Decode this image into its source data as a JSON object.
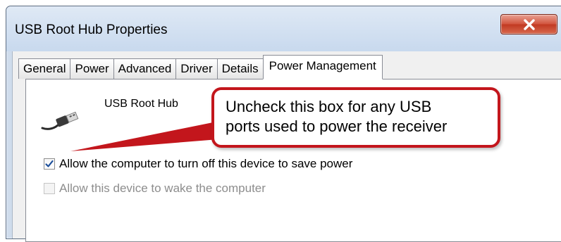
{
  "window": {
    "title": "USB Root Hub Properties"
  },
  "tabs": [
    {
      "label": "General",
      "active": false
    },
    {
      "label": "Power",
      "active": false
    },
    {
      "label": "Advanced",
      "active": false
    },
    {
      "label": "Driver",
      "active": false
    },
    {
      "label": "Details",
      "active": false
    },
    {
      "label": "Power Management",
      "active": true
    }
  ],
  "device": {
    "name": "USB Root Hub",
    "icon": "usb-plug-icon"
  },
  "options": [
    {
      "label": "Allow the computer to turn off this device to save power",
      "checked": true,
      "enabled": true
    },
    {
      "label": "Allow this device to wake the computer",
      "checked": false,
      "enabled": false
    }
  ],
  "callout": {
    "lines": [
      "Uncheck this box for any USB",
      "ports used to power the receiver"
    ],
    "border_color": "#c3161c"
  },
  "colors": {
    "close_button": "#c13a22",
    "accent_check": "#1c4e9a"
  }
}
